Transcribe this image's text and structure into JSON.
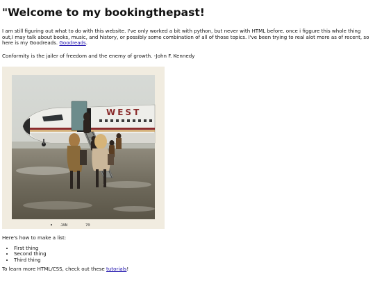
{
  "header": {
    "title": "\"Welcome to my bookingthepast!"
  },
  "intro": {
    "text": "I am still figuring out what to do with this website. I've only worked a bit with python, but never with HTML before. once i figgure this whole thing out,I may talk about books, music, and history, or possibly some combination of all of those topics. I've been trying to real alot more as of recent, so here is my Goodreads.",
    "link_label": "Goodreads",
    "after_link": "."
  },
  "quote": {
    "text": "Conformity is the jailer of freedom and the enemy of growth. -John F. Kennedy"
  },
  "photo": {
    "airline_lettering": "WEST",
    "date_stamp_month": "JAN",
    "date_stamp_year": "70"
  },
  "list": {
    "intro": "Here's how to make a list:",
    "items": [
      "First thing",
      "Second thing",
      "Third thing"
    ]
  },
  "outro": {
    "before_link": "To learn more HTML/CSS, check out these ",
    "link_label": "tutorials",
    "after_link": "!"
  }
}
